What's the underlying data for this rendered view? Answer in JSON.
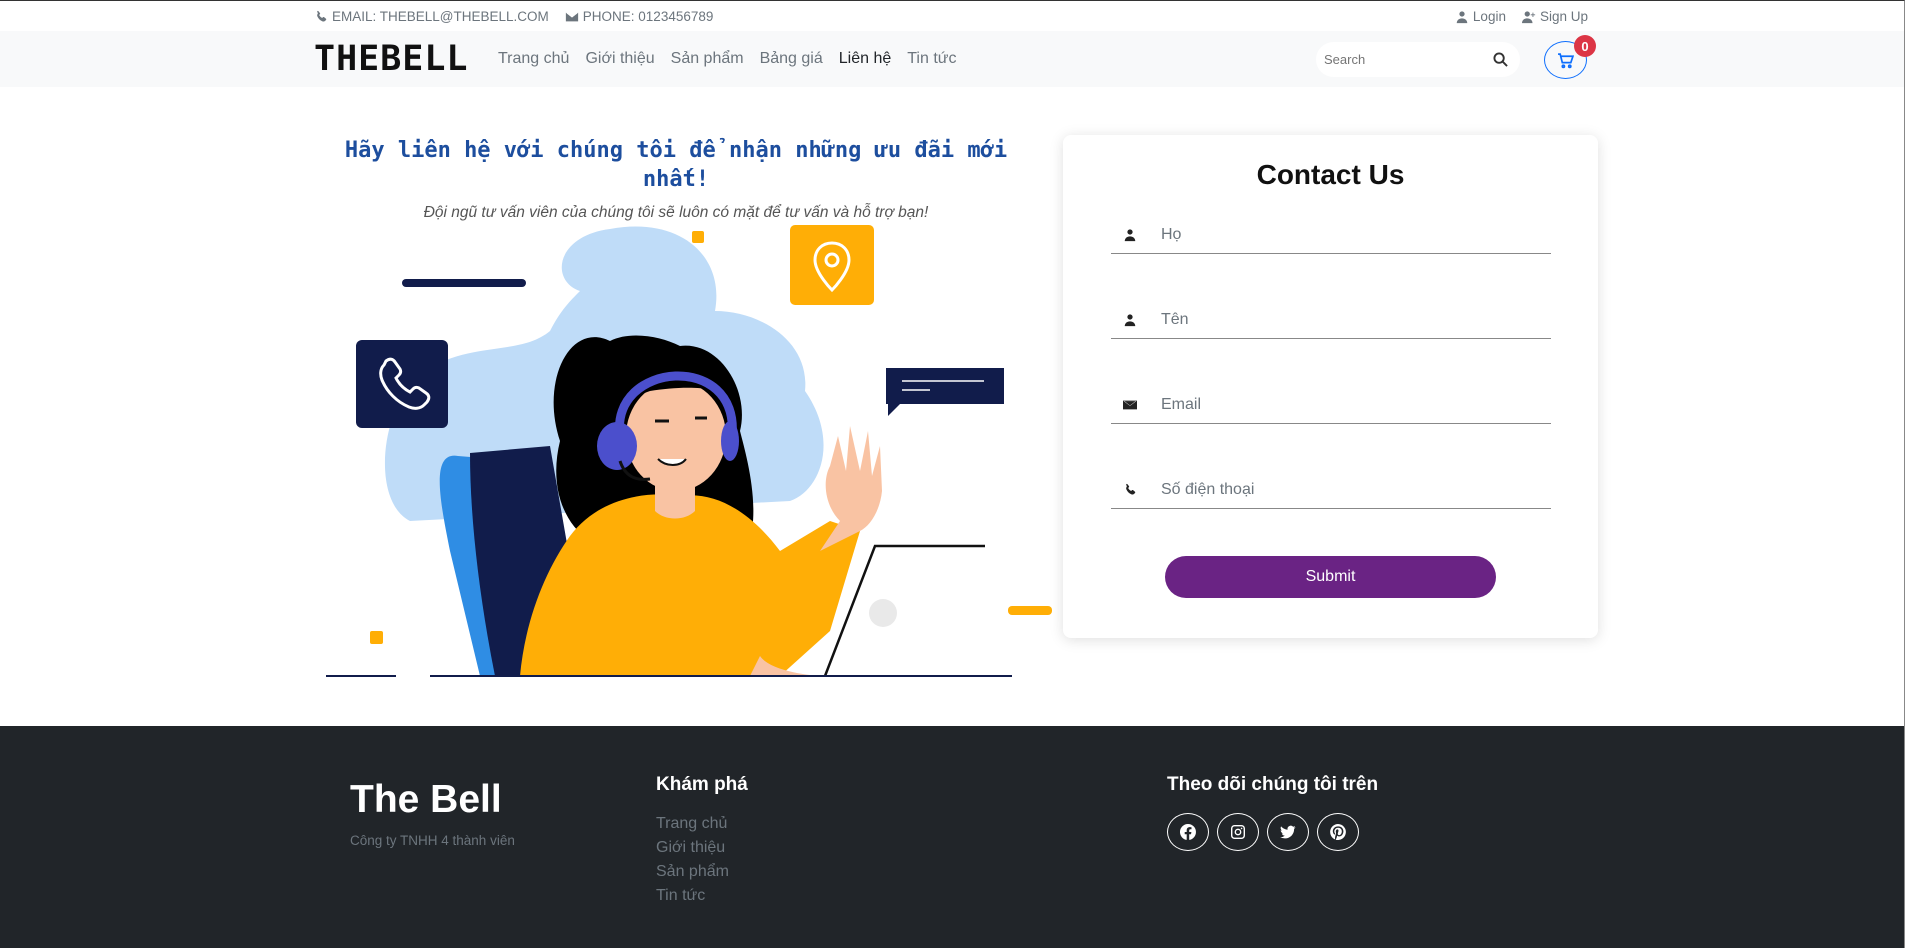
{
  "topbar": {
    "email": "EMAIL: THEBELL@THEBELL.COM",
    "phone": "PHONE: 0123456789",
    "login": "Login",
    "signup": "Sign Up"
  },
  "navbar": {
    "logo": "THEBELL",
    "items": [
      "Trang chủ",
      "Giới thiệu",
      "Sản phẩm",
      "Bảng giá",
      "Liên hệ",
      "Tin tức"
    ],
    "active": "Liên hệ",
    "search_placeholder": "Search",
    "cart_count": "0"
  },
  "hero": {
    "headline": "Hãy liên hệ với chúng tôi để nhận những ưu đãi mới nhất!",
    "subline": "Đội ngũ tư vấn viên của chúng tôi sẽ luôn có mặt để tư vấn và hỗ trợ bạn!"
  },
  "contact": {
    "title": "Contact Us",
    "fields": {
      "last_name": "Họ",
      "first_name": "Tên",
      "email": "Email",
      "phone": "Số điện thoại"
    },
    "submit": "Submit"
  },
  "footer": {
    "brand": "The Bell",
    "tagline": "Công ty TNHH 4 thành viên",
    "explore_title": "Khám phá",
    "explore_links": [
      "Trang chủ",
      "Giới thiệu",
      "Sản phẩm",
      "Tin tức"
    ],
    "follow_title": "Theo dõi chúng tôi trên",
    "socials": [
      "facebook-icon",
      "instagram-icon",
      "twitter-icon",
      "pinterest-icon"
    ]
  },
  "colors": {
    "accent": "#0d6efd",
    "submit": "#6a2384",
    "headline": "#1d4e9e",
    "footer_bg": "#212529",
    "badge": "#dc3545",
    "illustration_yellow": "#ffae06",
    "illustration_navy": "#111c4b",
    "illustration_blue": "#bfdcf8"
  }
}
